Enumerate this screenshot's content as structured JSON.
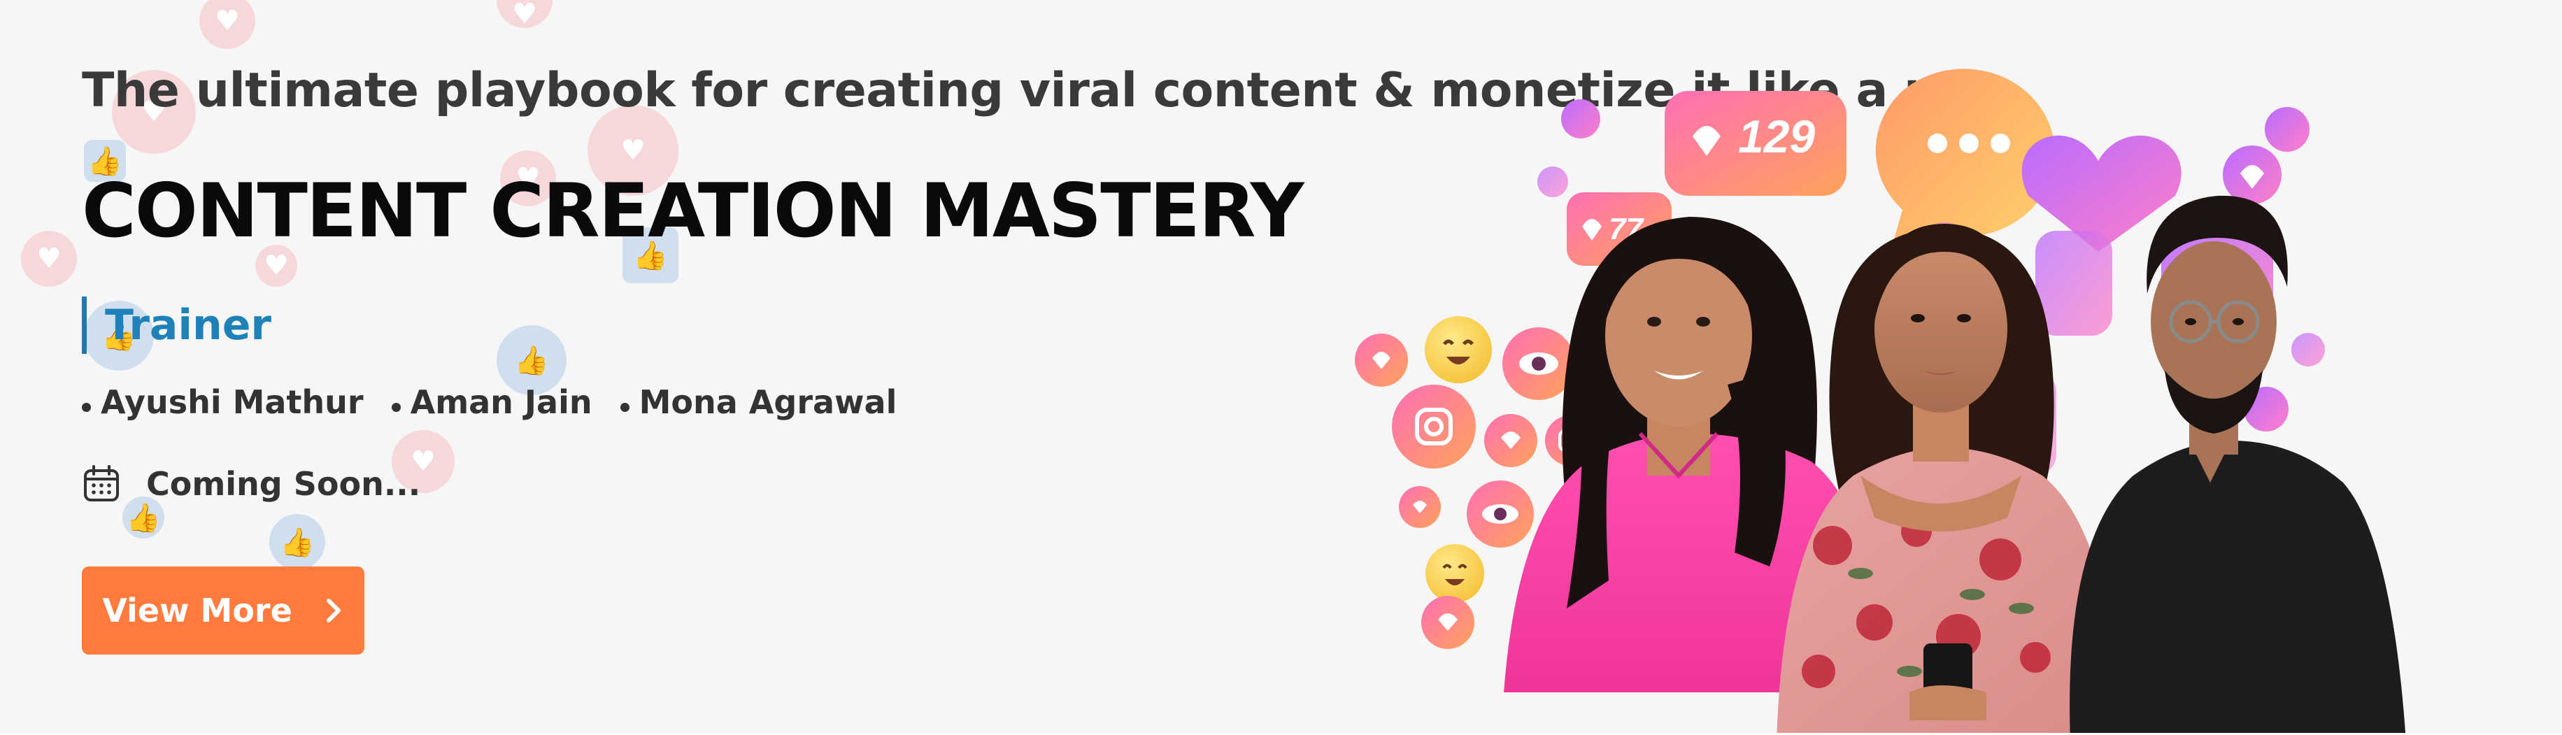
{
  "banner": {
    "tagline": "The ultimate playbook for creating viral content & monetize it like a pro",
    "title": "CONTENT CREATION MASTERY",
    "trainer_heading": "Trainer",
    "trainers": [
      {
        "name": "Ayushi Mathur"
      },
      {
        "name": "Aman Jain"
      },
      {
        "name": "Mona Agrawal"
      }
    ],
    "date_icon": "calendar-icon",
    "date_text": "Coming Soon...",
    "cta": {
      "label": "View More",
      "icon": "chevron-right-icon"
    },
    "hero": {
      "badges": {
        "likes_large": "129",
        "likes_small": "77"
      }
    },
    "colors": {
      "background": "#f6f6f6",
      "accent_blue": "#1e82b8",
      "cta_orange": "#ff7a3c",
      "title_black": "#0a0a0a",
      "text_gray": "#333333"
    }
  }
}
